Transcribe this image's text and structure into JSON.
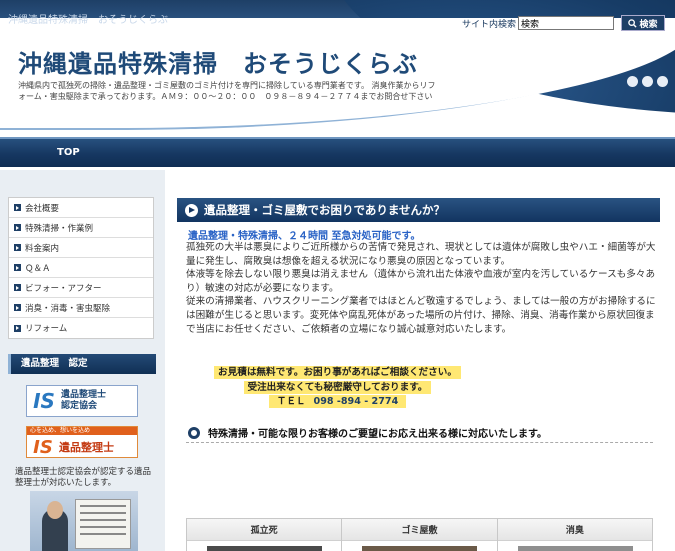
{
  "header": {
    "top_small": "沖縄遺品特殊清掃　おそうじくらぶ",
    "title": "沖縄遺品特殊清掃　おそうじくらぶ",
    "description": "沖縄県内で孤独死の掃除・遺品整理・ゴミ屋敷のゴミ片付けを専門に掃除している専門業者です。 消臭作業からリフォーム・害虫駆除まで承っております。ＡＭ９：００～２０：００　０９８－８９４－２７７４までお問合せ下さい",
    "search_label": "サイト内検索",
    "search_value": "検索",
    "search_button": "検索"
  },
  "nav": {
    "top": "TOP"
  },
  "sidebar": {
    "items": [
      {
        "label": "会社概要"
      },
      {
        "label": "特殊清掃・作業例"
      },
      {
        "label": "料金案内"
      },
      {
        "label": "Ｑ＆Ａ"
      },
      {
        "label": "ビフォー・アフター"
      },
      {
        "label": "消臭・消毒・害虫駆除"
      },
      {
        "label": "リフォーム"
      }
    ],
    "cert_heading": "遺品整理　認定",
    "banner1_logo": "IS",
    "banner1_line1": "遺品整理士",
    "banner1_line2": "認定協会",
    "banner2_top": "心を込め、想いを込め",
    "banner2_logo": "IS",
    "banner2_text": "遺品整理士",
    "cert_text": "遺品整理士認定協会が認定する遺品整理士が対応いたします。"
  },
  "main": {
    "heading": "遺品整理・ゴミ屋敷でお困りでありませんか？",
    "blue_line": "遺品整理・特殊清掃、２４時間 至急対処可能です。",
    "paragraph1": "孤独死の大半は悪臭によりご近所様からの苦情で発見され、現状としては遺体が腐敗し虫やハエ・細菌等が大量に発生し、腐敗臭は想像を超える状況になり悪臭の原因となっています。",
    "paragraph2": "体液等を除去しない限り悪臭は消えません（遺体から流れ出た体液や血液が室内を汚しているケースも多々あり）敏速の対応が必要になります。",
    "paragraph3": "従来の清掃業者、ハウスクリーニング業者ではほとんど敬遠するでしょう、ましては一般の方がお掃除するには困難が生じると思います。変死体や腐乱死体があった場所の片付け、掃除、消臭、消毒作業から原状回復まで当店にお任せください、ご依頼者の立場になり誠心誠意対応いたします。",
    "highlight1": "お見積は無料です。お困り事があればご相談ください。",
    "highlight2": "受注出来なくても秘密厳守しております。",
    "tel_label": "ＴＥＬ",
    "tel": "098 -894 - 2774",
    "sub_heading": "特殊清掃・可能な限りお客様のご要望にお応え出来る様に対応いたします。",
    "table_headers": [
      "孤立死",
      "ゴミ屋敷",
      "消臭"
    ]
  }
}
